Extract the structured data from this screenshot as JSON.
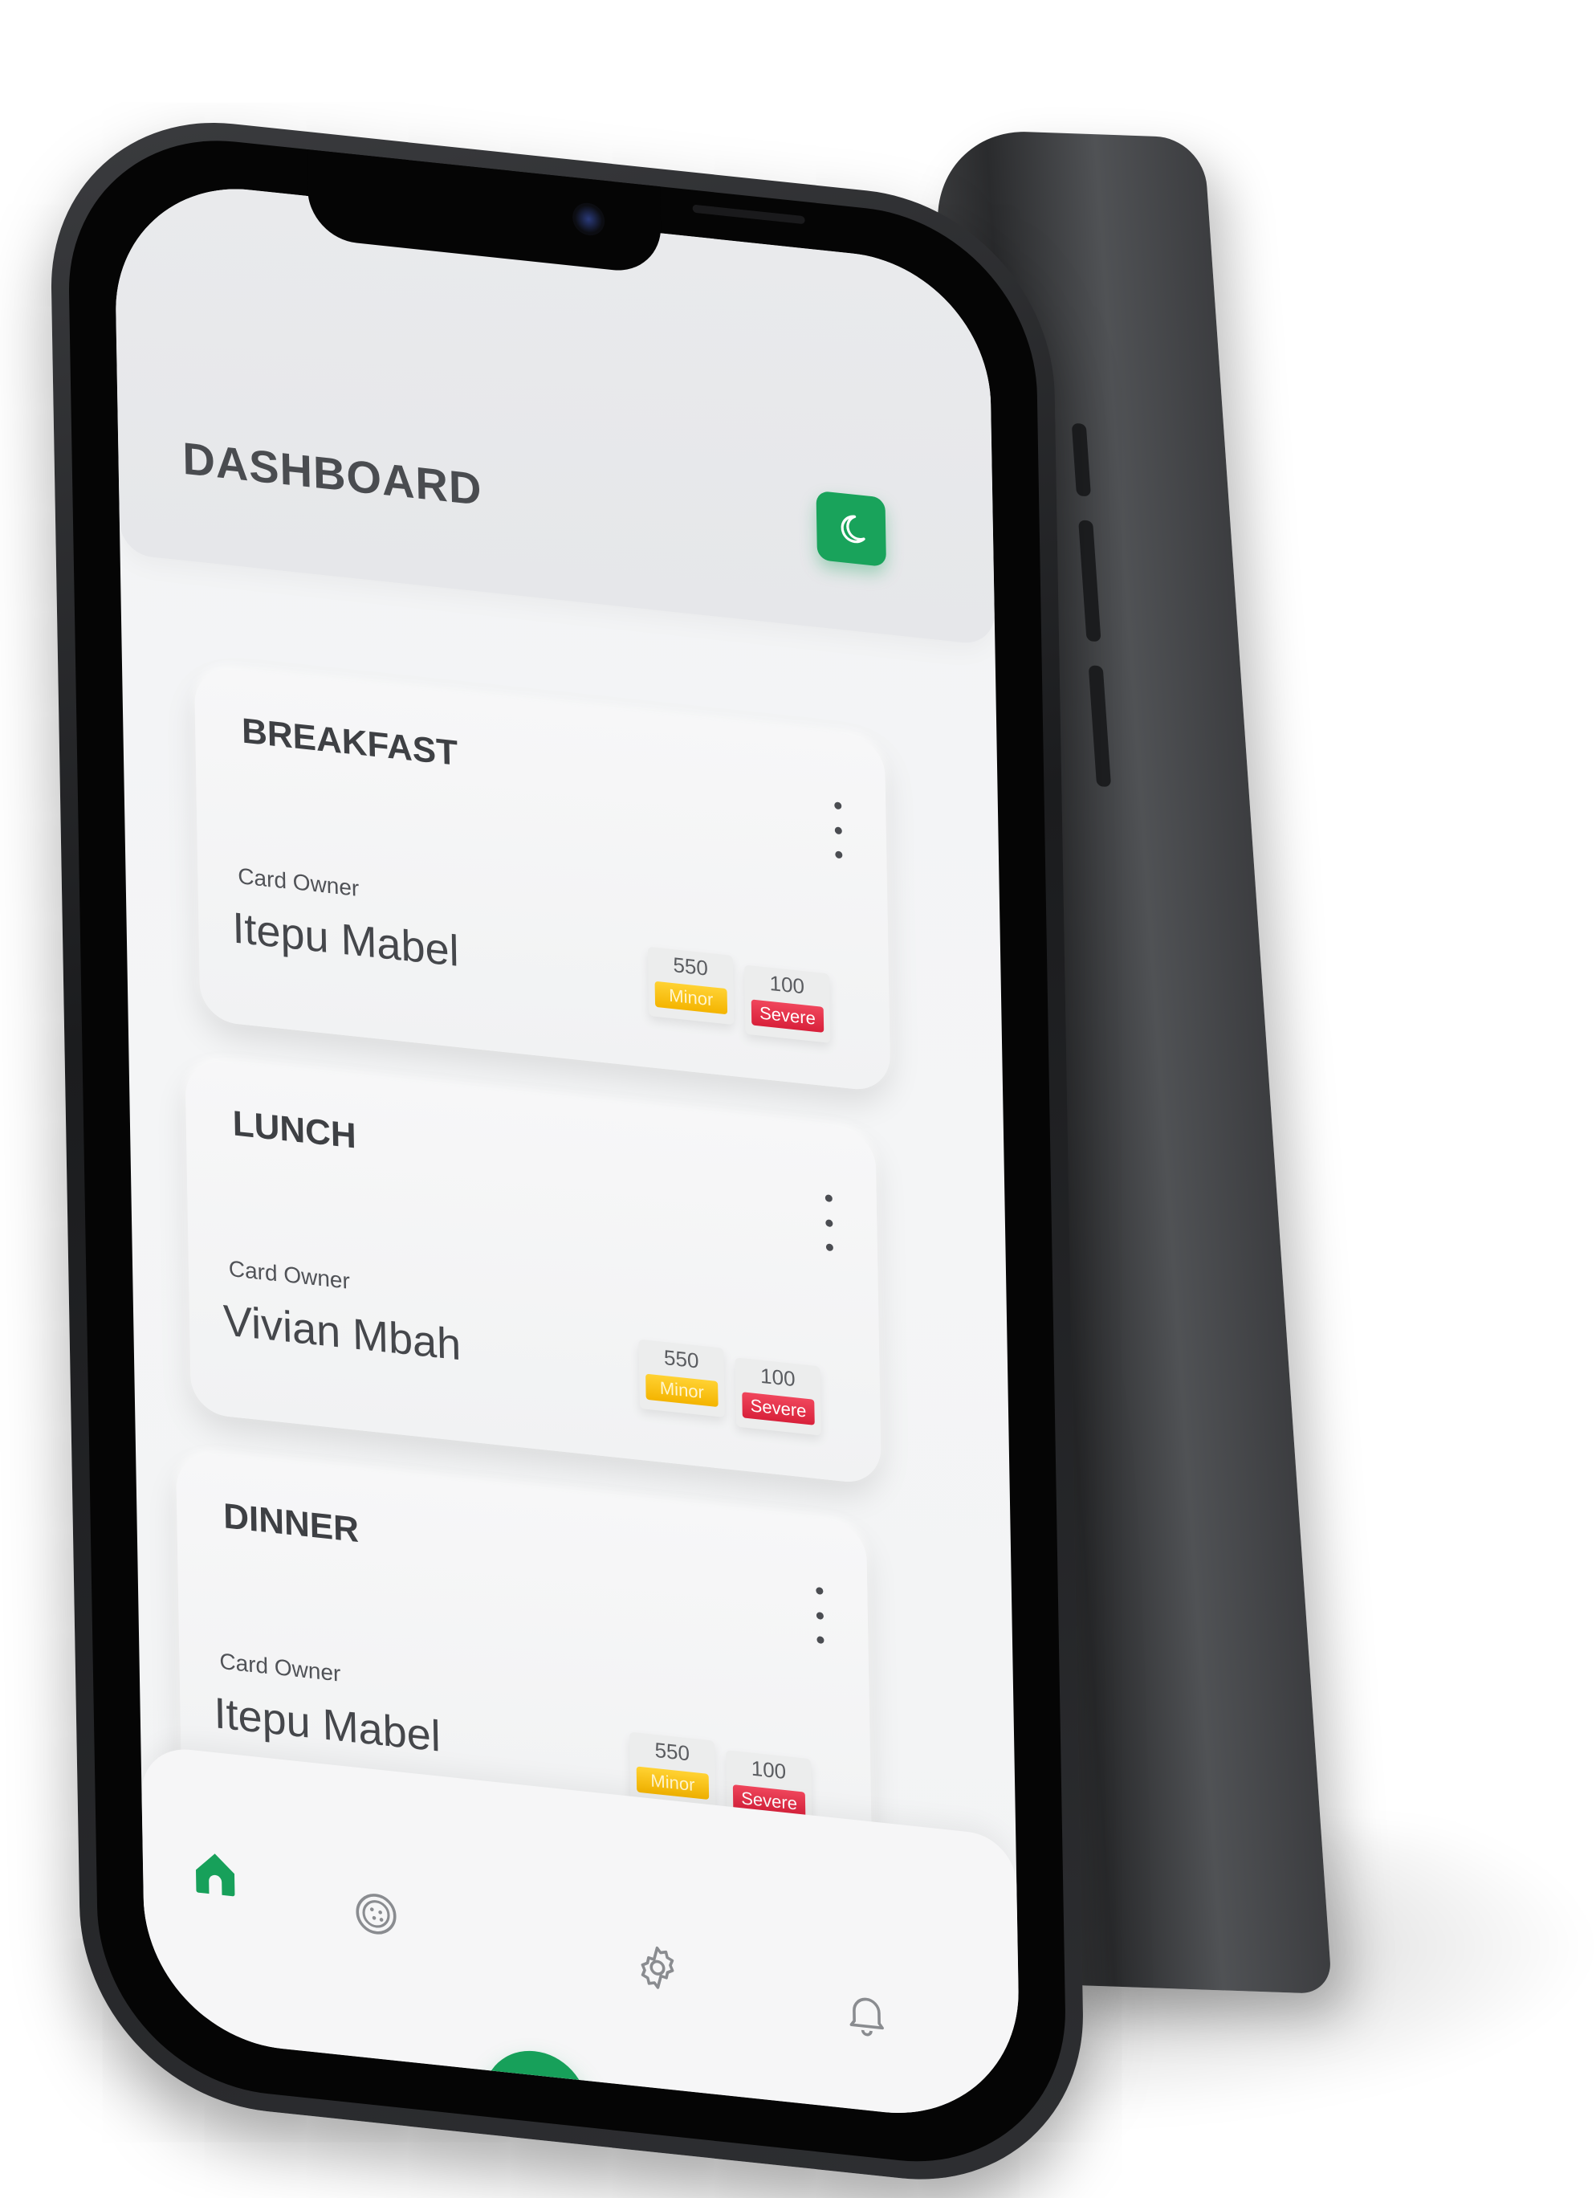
{
  "header": {
    "title": "DASHBOARD"
  },
  "theme_toggle": {
    "icon": "moon-icon",
    "color": "#19a35b"
  },
  "cards": [
    {
      "meal": "BREAKFAST",
      "owner_label": "Card Owner",
      "owner_name": "Itepu Mabel",
      "minor": {
        "value": "550",
        "label": "Minor"
      },
      "severe": {
        "value": "100",
        "label": "Severe"
      }
    },
    {
      "meal": "LUNCH",
      "owner_label": "Card Owner",
      "owner_name": "Vivian Mbah",
      "minor": {
        "value": "550",
        "label": "Minor"
      },
      "severe": {
        "value": "100",
        "label": "Severe"
      }
    },
    {
      "meal": "DINNER",
      "owner_label": "Card Owner",
      "owner_name": "Itepu Mabel",
      "minor": {
        "value": "550",
        "label": "Minor"
      },
      "severe": {
        "value": "100",
        "label": "Severe"
      }
    }
  ],
  "nav": {
    "items": [
      {
        "icon": "home-icon",
        "active": true
      },
      {
        "icon": "cookie-icon",
        "active": false
      },
      {
        "icon": "scan-icon",
        "active": false
      },
      {
        "icon": "gear-icon",
        "active": false
      },
      {
        "icon": "bell-icon",
        "active": false
      }
    ],
    "accent": "#17a05a"
  },
  "colors": {
    "minor": "#f4b400",
    "severe": "#d8203a",
    "accent": "#19a35b"
  }
}
